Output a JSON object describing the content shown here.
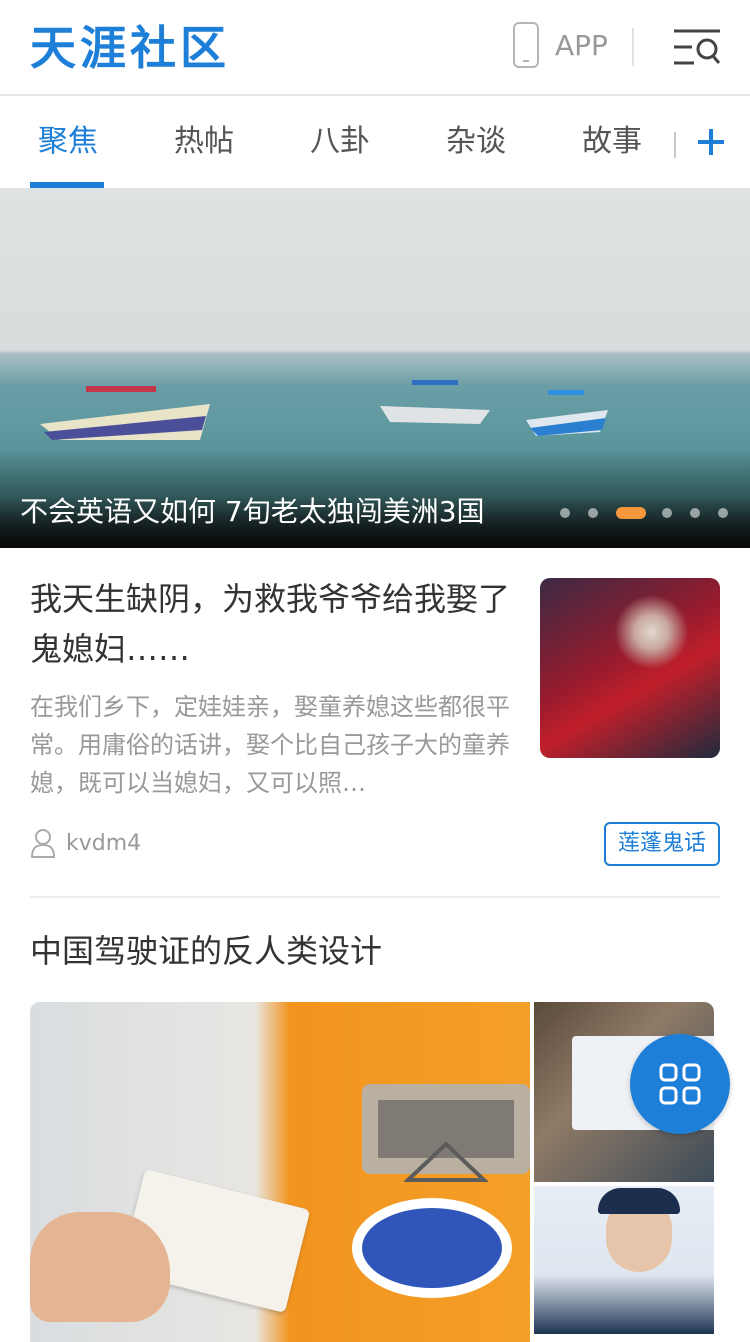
{
  "header": {
    "logo": "天涯社区",
    "app_label": "APP",
    "phone_icon": "phone-icon",
    "menu_icon": "menu-search-icon"
  },
  "tabs": {
    "items": [
      {
        "label": "聚焦",
        "active": true
      },
      {
        "label": "热帖",
        "active": false
      },
      {
        "label": "八卦",
        "active": false
      },
      {
        "label": "杂谈",
        "active": false
      },
      {
        "label": "故事",
        "active": false
      }
    ],
    "add_icon": "plus-icon",
    "accent_color": "#1d7fd8"
  },
  "banner": {
    "caption": "不会英语又如何 7旬老太独闯美洲3国",
    "slide_count": 6,
    "active_slide": 3,
    "active_dot_color": "#f5973a"
  },
  "feed": {
    "article1": {
      "title": "我天生缺阴，为救我爷爷给我娶了鬼媳妇……",
      "excerpt": "在我们乡下，定娃娃亲，娶童养媳这些都很平常。用庸俗的话讲，娶个比自己孩子大的童养媳，既可以当媳妇，又可以照…",
      "author": "kvdm4",
      "tag": "莲蓬鬼话"
    },
    "article2": {
      "title": "中国驾驶证的反人类设计"
    }
  },
  "fab": {
    "icon": "apps-grid-icon"
  }
}
